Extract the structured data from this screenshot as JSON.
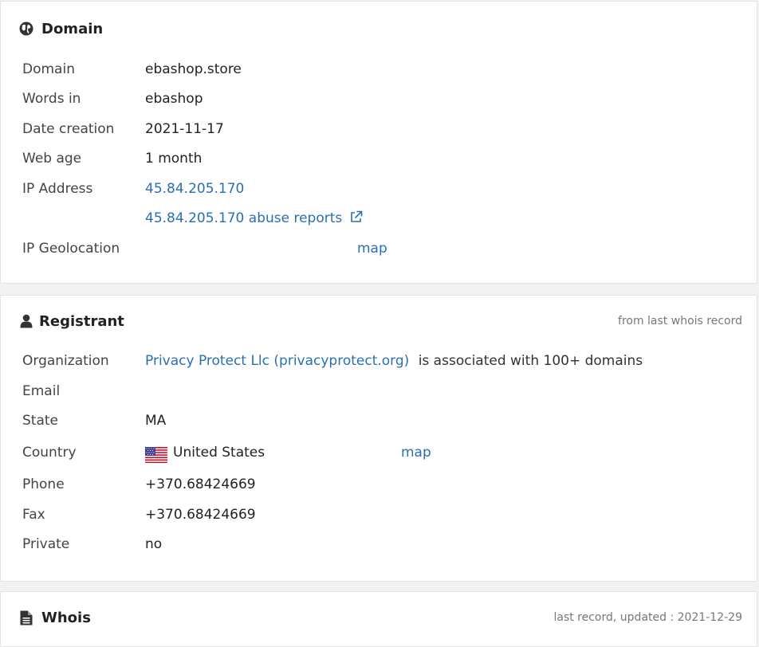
{
  "domain": {
    "title": "Domain",
    "icon": "globe-icon",
    "rows": {
      "domain": {
        "label": "Domain",
        "value": "ebashop.store"
      },
      "words": {
        "label": "Words in",
        "value": "ebashop"
      },
      "created": {
        "label": "Date creation",
        "value": "2021-11-17"
      },
      "age": {
        "label": "Web age",
        "value": "1 month"
      },
      "ip": {
        "label": "IP Address",
        "value": "45.84.205.170"
      },
      "abuse": {
        "value": "45.84.205.170 abuse reports"
      },
      "geo": {
        "label": "IP Geolocation",
        "link": "map"
      }
    }
  },
  "registrant": {
    "title": "Registrant",
    "icon": "user-icon",
    "note": "from last whois record",
    "rows": {
      "org": {
        "label": "Organization",
        "link": "Privacy Protect Llc (privacyprotect.org)",
        "suffix": "is associated with 100+ domains"
      },
      "email": {
        "label": "Email",
        "value": ""
      },
      "state": {
        "label": "State",
        "value": "MA"
      },
      "country": {
        "label": "Country",
        "value": "United States",
        "link": "map"
      },
      "phone": {
        "label": "Phone",
        "value": "+370.68424669"
      },
      "fax": {
        "label": "Fax",
        "value": "+370.68424669"
      },
      "private": {
        "label": "Private",
        "value": "no"
      }
    }
  },
  "whois": {
    "title": "Whois",
    "icon": "document-icon",
    "note": "last record, updated : 2021-12-29"
  },
  "colors": {
    "link": "#2a6fb3",
    "text": "#222222",
    "label": "#444444",
    "note": "#777777"
  }
}
